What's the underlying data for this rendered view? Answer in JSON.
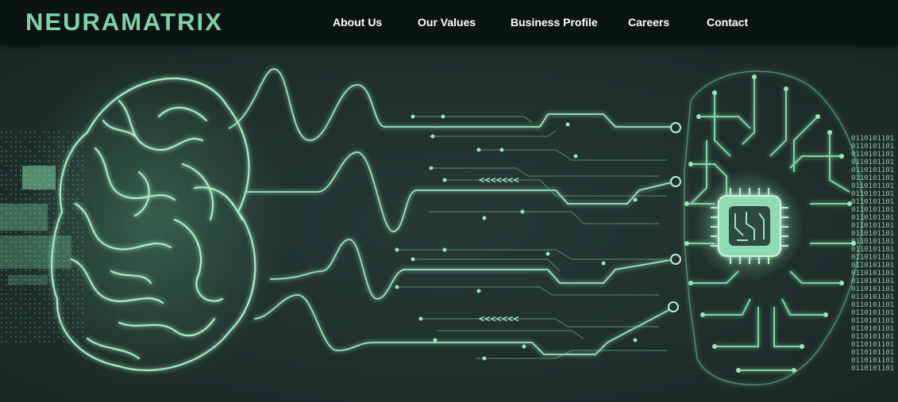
{
  "brand": {
    "name": "NEURAMATRIX"
  },
  "nav": {
    "items": [
      {
        "label": "About Us"
      },
      {
        "label": "Our Values"
      },
      {
        "label": "Business Profile"
      },
      {
        "label": "Careers"
      },
      {
        "label": "Contact"
      }
    ]
  },
  "hero": {
    "binary_text": "0110101101",
    "arrow_text": "<<<<<<<"
  },
  "colors": {
    "topbar": "#0b1413",
    "background": "#1f302d",
    "glow": "#7fd3a6",
    "line": "#9fe3bf",
    "nav_text": "#ffffff"
  },
  "icons": [
    "brain-illustration",
    "signal-waves",
    "circuit-head",
    "chip-icon"
  ]
}
